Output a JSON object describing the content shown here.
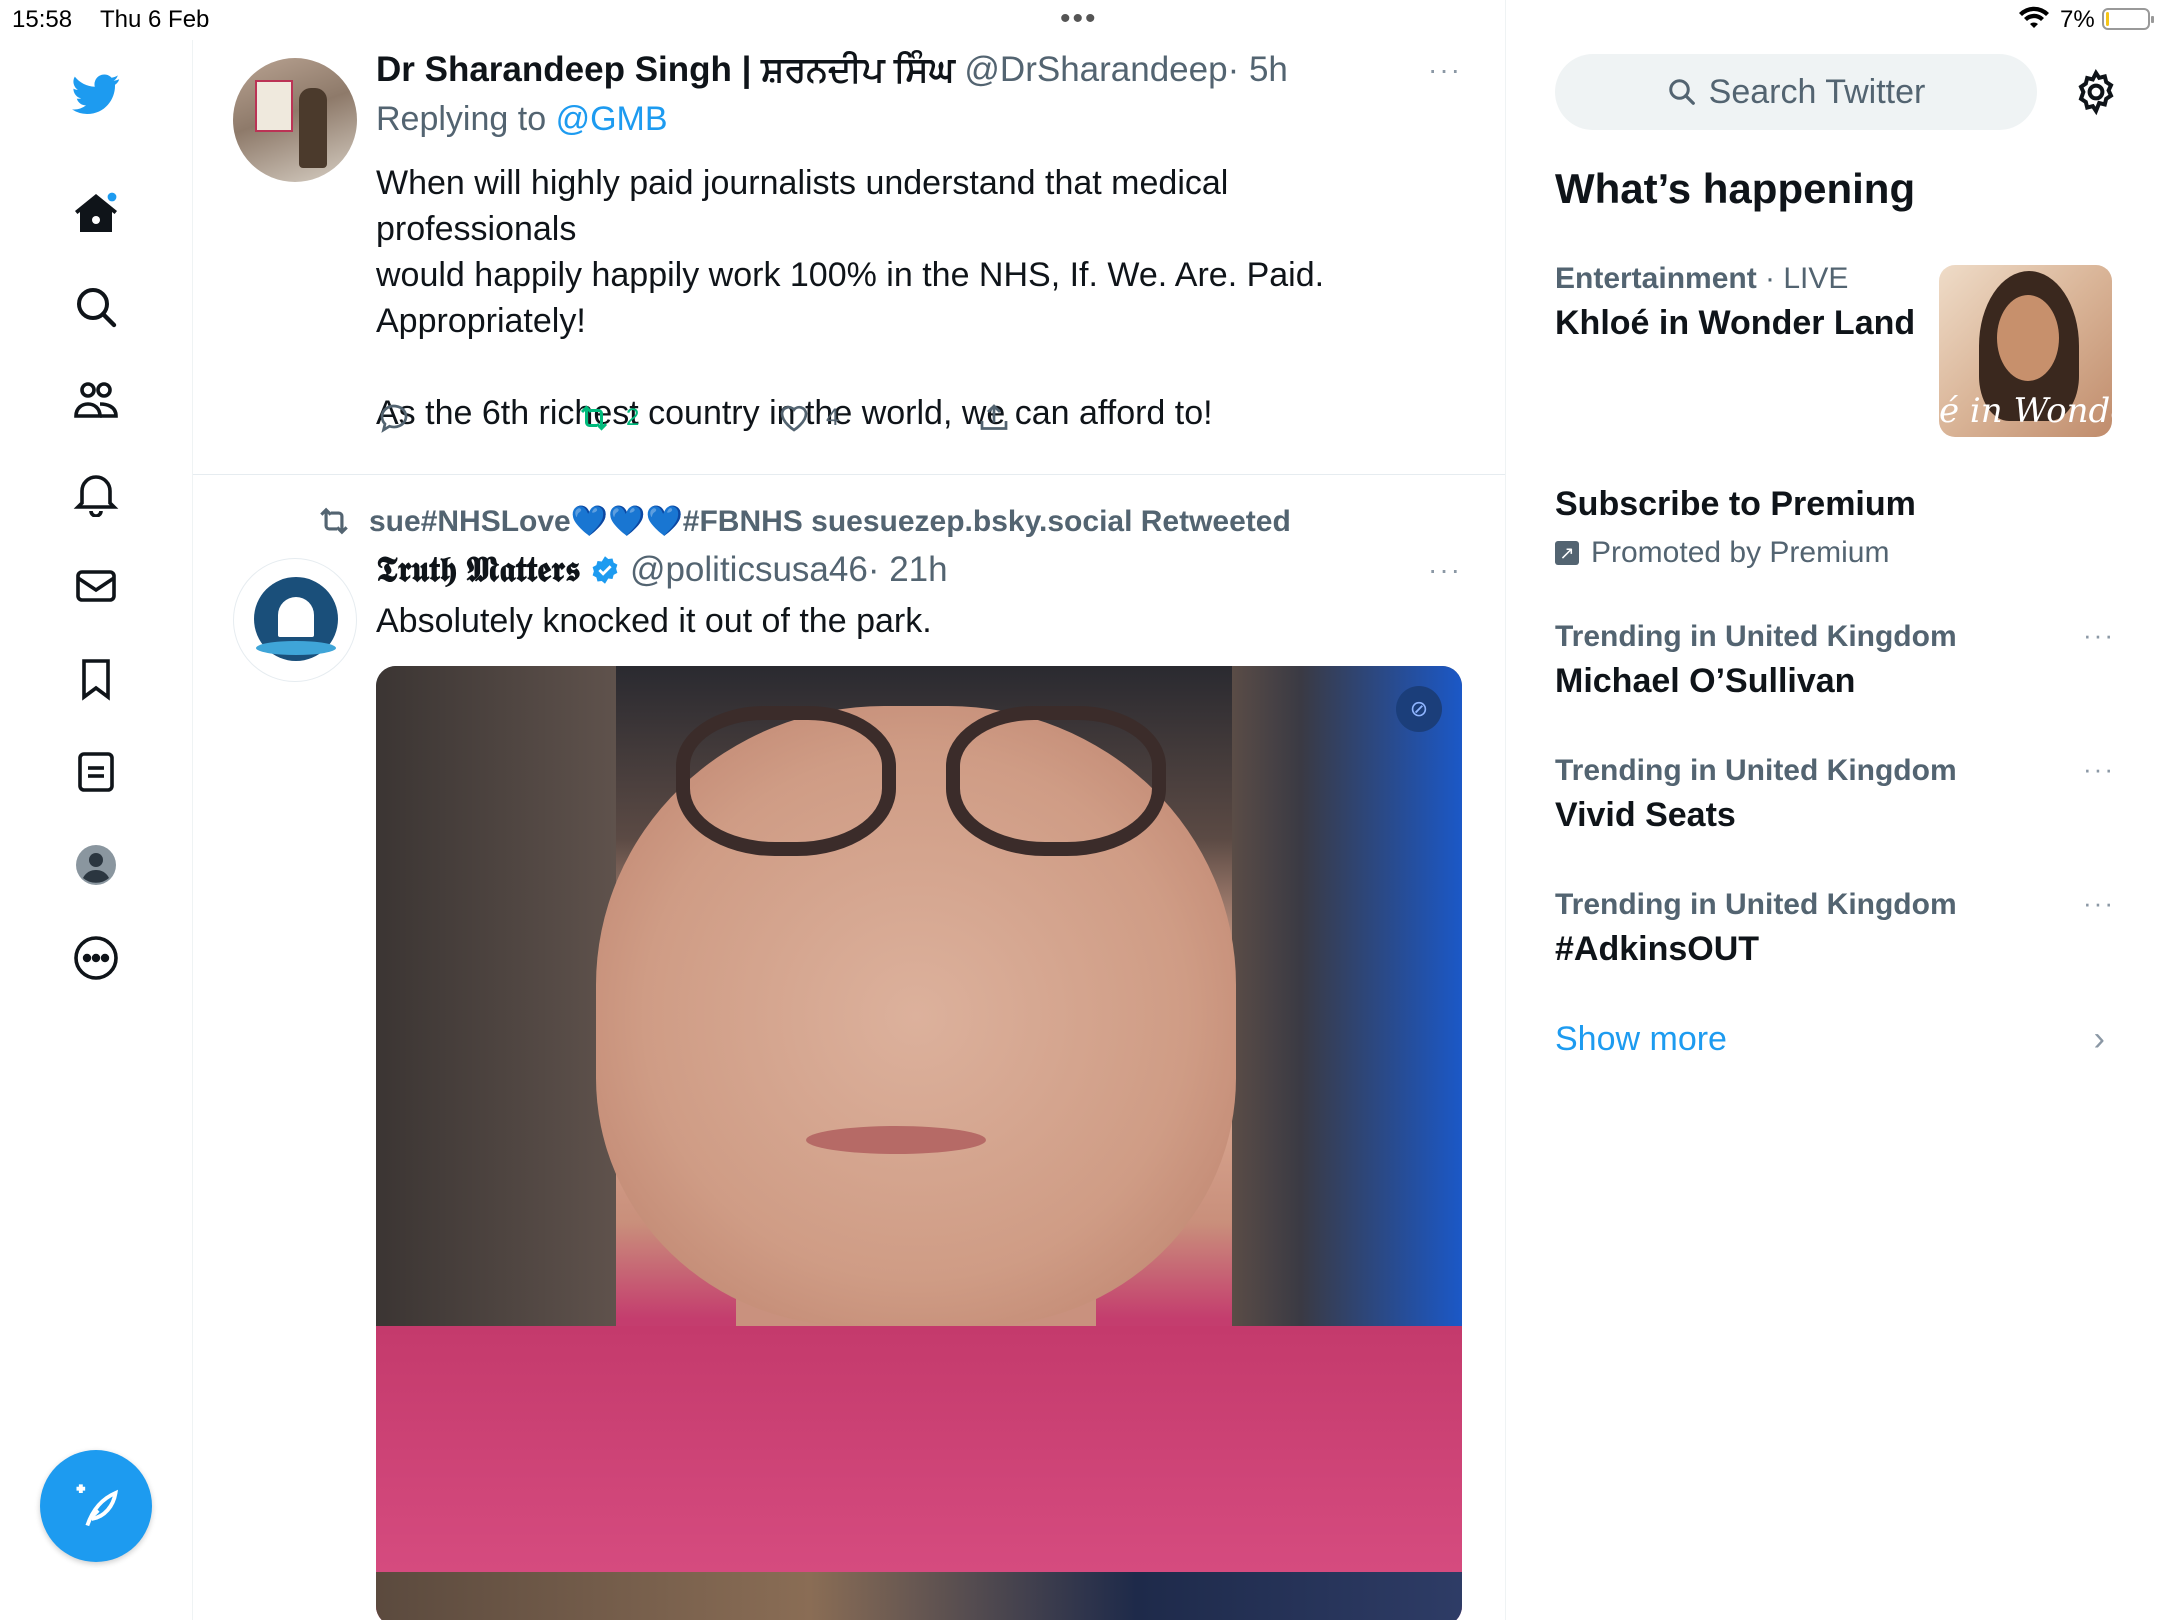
{
  "status_bar": {
    "time": "15:58",
    "date": "Thu 6 Feb",
    "battery_pct": "7%",
    "battery_level": 0.07
  },
  "nav": {
    "items": [
      "home",
      "explore",
      "communities",
      "notifications",
      "messages",
      "bookmarks",
      "lists",
      "profile",
      "more"
    ],
    "compose_icon": "compose-feather-icon",
    "accent": "#1d9bf0"
  },
  "tweet1": {
    "display_name": "Dr Sharandeep Singh | ਸ਼ਰਨਦੀਪ ਸਿੰਘ",
    "handle": "@DrSharandeep",
    "time": "· 5h",
    "replying_prefix": "Replying to",
    "replying_to": "@GMB",
    "text_line1": "When will highly paid journalists understand that medical professionals",
    "text_line2": "would happily happily work 100% in the NHS, If. We. Are. Paid.",
    "text_line3": "Appropriately!",
    "text_line4": "As the 6th richest country in the world, we can afford to!",
    "retweets": "2",
    "likes": "4",
    "more": "···"
  },
  "tweet2": {
    "retweeted_by": "sue#NHSLove💙💙💙#FBNHS suesuezep.bsky.social Retweeted",
    "display_name": "𝕿𝖗𝖚𝖙𝖍 𝕸𝖆𝖙𝖙𝖊𝖗𝖘",
    "handle": "@politicsusa46",
    "time": "· 21h",
    "text": "Absolutely knocked it out of the park.",
    "more": "···"
  },
  "sidebar": {
    "search_placeholder": "Search Twitter",
    "section_title": "What’s happening",
    "trend_live": {
      "category": "Entertainment",
      "status": " · LIVE",
      "title": "Khloé in Wonder Land",
      "image_text": "é in Wonder L"
    },
    "promo": {
      "title": "Subscribe to Premium",
      "meta": "Promoted by Premium"
    },
    "trends": [
      {
        "meta": "Trending in United Kingdom",
        "title": "Michael O’Sullivan"
      },
      {
        "meta": "Trending in United Kingdom",
        "title": "Vivid Seats"
      },
      {
        "meta": "Trending in United Kingdom",
        "title": "#AdkinsOUT"
      }
    ],
    "show_more": "Show more"
  }
}
